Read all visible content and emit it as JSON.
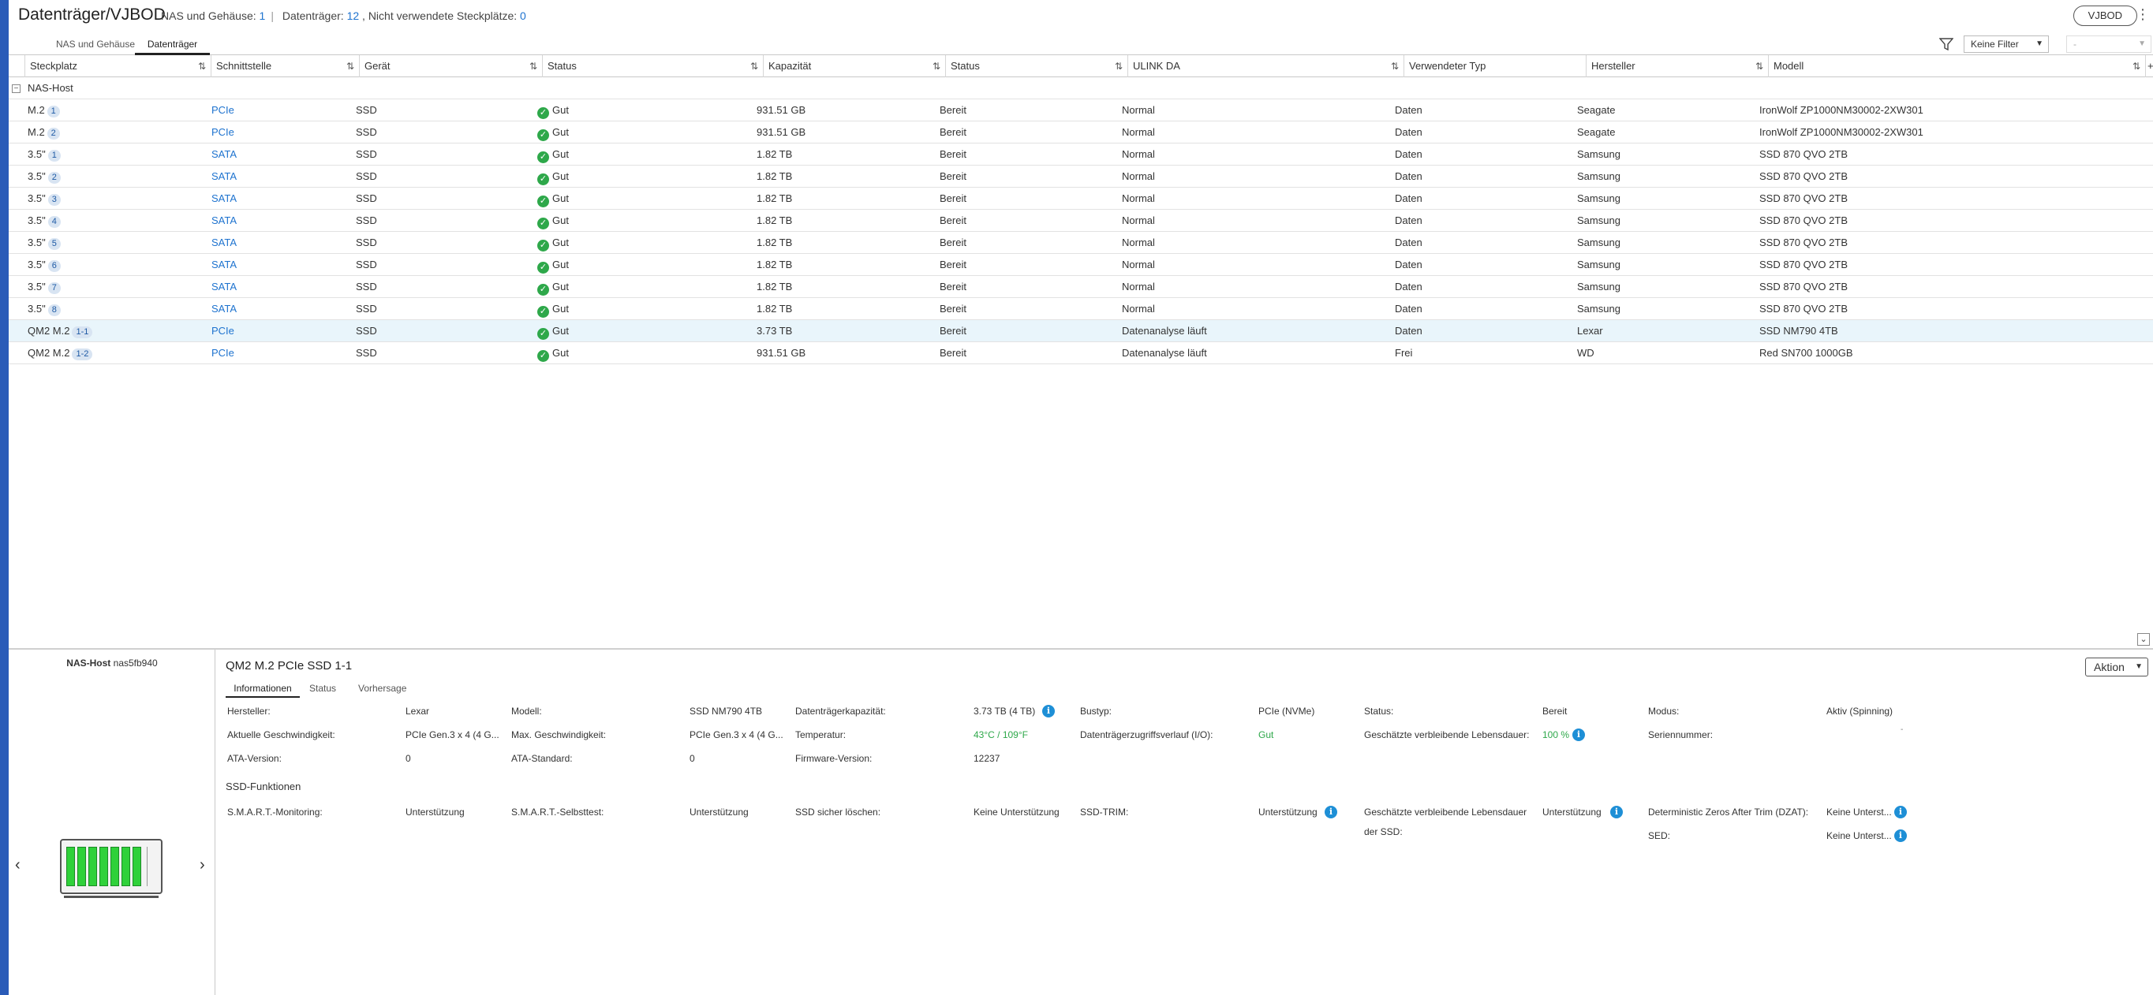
{
  "header": {
    "title": "Datenträger/VJBOD",
    "nas_label": "NAS und Gehäuse:",
    "nas_value": "1",
    "disk_label": "Datenträger:",
    "disk_value": "12",
    "unused_label": ", Nicht verwendete Steckplätze:",
    "unused_value": "0",
    "vjbod_button": "VJBOD"
  },
  "tabs": [
    {
      "label": "NAS und Gehäuse"
    },
    {
      "label": "Datenträger"
    }
  ],
  "filter": {
    "value": "Keine Filter",
    "second_value": "-"
  },
  "columns": [
    "Steckplatz",
    "Schnittstelle",
    "Gerät",
    "Status",
    "Kapazität",
    "Status",
    "ULINK DA",
    "Verwendeter Typ",
    "Hersteller",
    "Modell"
  ],
  "group": {
    "label": "NAS-Host"
  },
  "rows": [
    {
      "slot": "M.2",
      "slot_no": "1",
      "interface": "PCIe",
      "device": "SSD",
      "health": "Gut",
      "capacity": "931.51 GB",
      "status": "Bereit",
      "ulink": "Normal",
      "type": "Daten",
      "vendor": "Seagate",
      "model": "IronWolf ZP1000NM30002-2XW301"
    },
    {
      "slot": "M.2",
      "slot_no": "2",
      "interface": "PCIe",
      "device": "SSD",
      "health": "Gut",
      "capacity": "931.51 GB",
      "status": "Bereit",
      "ulink": "Normal",
      "type": "Daten",
      "vendor": "Seagate",
      "model": "IronWolf ZP1000NM30002-2XW301"
    },
    {
      "slot": "3.5\"",
      "slot_no": "1",
      "interface": "SATA",
      "device": "SSD",
      "health": "Gut",
      "capacity": "1.82 TB",
      "status": "Bereit",
      "ulink": "Normal",
      "type": "Daten",
      "vendor": "Samsung",
      "model": "SSD 870 QVO 2TB"
    },
    {
      "slot": "3.5\"",
      "slot_no": "2",
      "interface": "SATA",
      "device": "SSD",
      "health": "Gut",
      "capacity": "1.82 TB",
      "status": "Bereit",
      "ulink": "Normal",
      "type": "Daten",
      "vendor": "Samsung",
      "model": "SSD 870 QVO 2TB"
    },
    {
      "slot": "3.5\"",
      "slot_no": "3",
      "interface": "SATA",
      "device": "SSD",
      "health": "Gut",
      "capacity": "1.82 TB",
      "status": "Bereit",
      "ulink": "Normal",
      "type": "Daten",
      "vendor": "Samsung",
      "model": "SSD 870 QVO 2TB"
    },
    {
      "slot": "3.5\"",
      "slot_no": "4",
      "interface": "SATA",
      "device": "SSD",
      "health": "Gut",
      "capacity": "1.82 TB",
      "status": "Bereit",
      "ulink": "Normal",
      "type": "Daten",
      "vendor": "Samsung",
      "model": "SSD 870 QVO 2TB"
    },
    {
      "slot": "3.5\"",
      "slot_no": "5",
      "interface": "SATA",
      "device": "SSD",
      "health": "Gut",
      "capacity": "1.82 TB",
      "status": "Bereit",
      "ulink": "Normal",
      "type": "Daten",
      "vendor": "Samsung",
      "model": "SSD 870 QVO 2TB"
    },
    {
      "slot": "3.5\"",
      "slot_no": "6",
      "interface": "SATA",
      "device": "SSD",
      "health": "Gut",
      "capacity": "1.82 TB",
      "status": "Bereit",
      "ulink": "Normal",
      "type": "Daten",
      "vendor": "Samsung",
      "model": "SSD 870 QVO 2TB"
    },
    {
      "slot": "3.5\"",
      "slot_no": "7",
      "interface": "SATA",
      "device": "SSD",
      "health": "Gut",
      "capacity": "1.82 TB",
      "status": "Bereit",
      "ulink": "Normal",
      "type": "Daten",
      "vendor": "Samsung",
      "model": "SSD 870 QVO 2TB"
    },
    {
      "slot": "3.5\"",
      "slot_no": "8",
      "interface": "SATA",
      "device": "SSD",
      "health": "Gut",
      "capacity": "1.82 TB",
      "status": "Bereit",
      "ulink": "Normal",
      "type": "Daten",
      "vendor": "Samsung",
      "model": "SSD 870 QVO 2TB"
    },
    {
      "slot": "QM2 M.2",
      "slot_no": "1-1",
      "interface": "PCIe",
      "device": "SSD",
      "health": "Gut",
      "capacity": "3.73 TB",
      "status": "Bereit",
      "ulink": "Datenanalyse läuft",
      "type": "Daten",
      "vendor": "Lexar",
      "model": "SSD NM790 4TB"
    },
    {
      "slot": "QM2 M.2",
      "slot_no": "1-2",
      "interface": "PCIe",
      "device": "SSD",
      "health": "Gut",
      "capacity": "931.51 GB",
      "status": "Bereit",
      "ulink": "Datenanalyse läuft",
      "type": "Frei",
      "vendor": "WD",
      "model": "Red SN700 1000GB"
    }
  ],
  "nas_panel": {
    "title_bold": "NAS-Host",
    "title_name": "nas5fb940"
  },
  "details": {
    "title": "QM2 M.2 PCIe SSD 1-1",
    "action_button": "Aktion",
    "tabs": [
      "Informationen",
      "Status",
      "Vorhersage"
    ],
    "info": [
      {
        "label": "Hersteller:",
        "value": "Lexar"
      },
      {
        "label": "Modell:",
        "value": "SSD NM790 4TB"
      },
      {
        "label": "Datenträgerkapazität:",
        "value": "3.73 TB (4 TB)"
      },
      {
        "label": "Bustyp:",
        "value": "PCIe (NVMe)"
      },
      {
        "label": "Status:",
        "value": "Bereit"
      },
      {
        "label": "Modus:",
        "value": "Aktiv (Spinning)"
      },
      {
        "label": "Aktuelle Geschwindigkeit:",
        "value": "PCIe Gen.3 x 4 (4 G..."
      },
      {
        "label": "Max. Geschwindigkeit:",
        "value": "PCIe Gen.3 x 4 (4 G..."
      },
      {
        "label": "Temperatur:",
        "value": "43°C / 109°F"
      },
      {
        "label": "Datenträgerzugriffsverlauf (I/O):",
        "value": "Gut"
      },
      {
        "label": "Geschätzte verbleibende Lebensdauer:",
        "value": "100 %"
      },
      {
        "label": "Seriennummer:",
        "value": "-"
      },
      {
        "label": "ATA-Version:",
        "value": "0"
      },
      {
        "label": "ATA-Standard:",
        "value": "0"
      },
      {
        "label": "Firmware-Version:",
        "value": "12237"
      }
    ],
    "ssd_section_title": "SSD-Funktionen",
    "ssd": [
      {
        "label": "S.M.A.R.T.-Monitoring:",
        "value": "Unterstützung"
      },
      {
        "label": "S.M.A.R.T.-Selbsttest:",
        "value": "Unterstützung"
      },
      {
        "label": "SSD sicher löschen:",
        "value": "Keine Unterstützung"
      },
      {
        "label": "SSD-TRIM:",
        "value": "Unterstützung"
      },
      {
        "label": "Geschätzte verbleibende Lebensdauer",
        "label2": "der SSD:",
        "value": "Unterstützung"
      },
      {
        "label": "Deterministic Zeros After Trim (DZAT):",
        "value": "Keine Unterst..."
      },
      {
        "label": "SED:",
        "value": "Keine Unterst..."
      }
    ]
  }
}
